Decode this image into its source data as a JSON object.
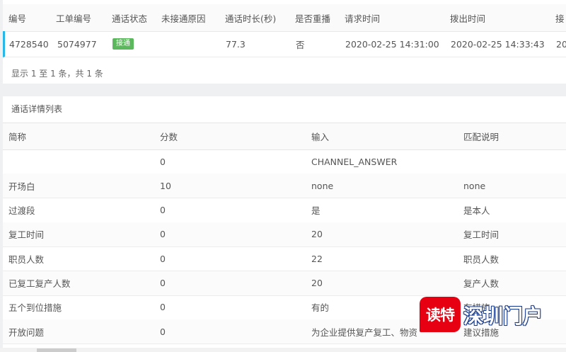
{
  "calls_table": {
    "headers": [
      "编号",
      "工单编号",
      "通话状态",
      "未接通原因",
      "通话时长(秒)",
      "是否重播",
      "请求时间",
      "拨出时间",
      "接"
    ],
    "row": {
      "id": "4728540",
      "ticket": "5074977",
      "status": "接通",
      "reason": "",
      "duration": "77.3",
      "replay": "否",
      "request_time": "2020-02-25 14:31:00",
      "dial_time": "2020-02-25 14:33:43",
      "extra": "20"
    },
    "pager": "显示 1 至 1 条，共 1 条"
  },
  "detail": {
    "title": "通话详情列表",
    "headers": [
      "简称",
      "分数",
      "输入",
      "匹配说明"
    ],
    "rows": [
      [
        "",
        "0",
        "CHANNEL_ANSWER",
        ""
      ],
      [
        "开场白",
        "10",
        "none",
        "none"
      ],
      [
        "过渡段",
        "0",
        "是",
        "是本人"
      ],
      [
        "复工时间",
        "0",
        "20",
        "复工时间"
      ],
      [
        "职员人数",
        "0",
        "22",
        "职员人数"
      ],
      [
        "已复工复产人数",
        "0",
        "20",
        "复产人数"
      ],
      [
        "五个到位措施",
        "0",
        "有的",
        "有措施"
      ],
      [
        "开放问题",
        "0",
        "为企业提供复产复工、物资",
        "建议措施"
      ]
    ]
  },
  "watermark": {
    "logo": "读特",
    "text": "深圳门户"
  },
  "colors": {
    "status_green": "#5cb85c",
    "row_accent": "#26b7e8",
    "watermark_red": "#e60012"
  }
}
